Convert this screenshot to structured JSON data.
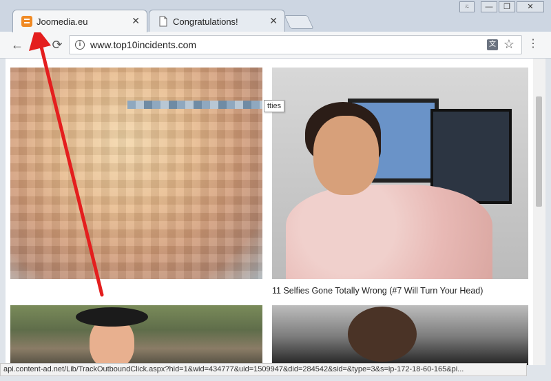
{
  "window": {
    "controls": [
      "⍨",
      "—",
      "❐",
      "✕"
    ]
  },
  "tabs": [
    {
      "label": "Joomedia.eu",
      "close": "✕"
    },
    {
      "label": "Congratulations!",
      "close": "✕"
    }
  ],
  "toolbar": {
    "back": "←",
    "forward": "→",
    "reload": "⟳",
    "url": "www.top10incidents.com",
    "info": "i",
    "translate": "文",
    "star": "☆",
    "menu": "⋮"
  },
  "content": {
    "tooltip": "tties",
    "caption_right": "11 Selfies Gone Totally Wrong (#7 Will Turn Your Head)"
  },
  "status": {
    "text": "api.content-ad.net/Lib/TrackOutboundClick.aspx?hid=1&wid=434777&uid=1509947&did=284542&sid=&type=3&s=ip-172-18-60-165&pi..."
  },
  "colors": {
    "arrow": "#e41e1e",
    "favicon": "#f08a24"
  }
}
